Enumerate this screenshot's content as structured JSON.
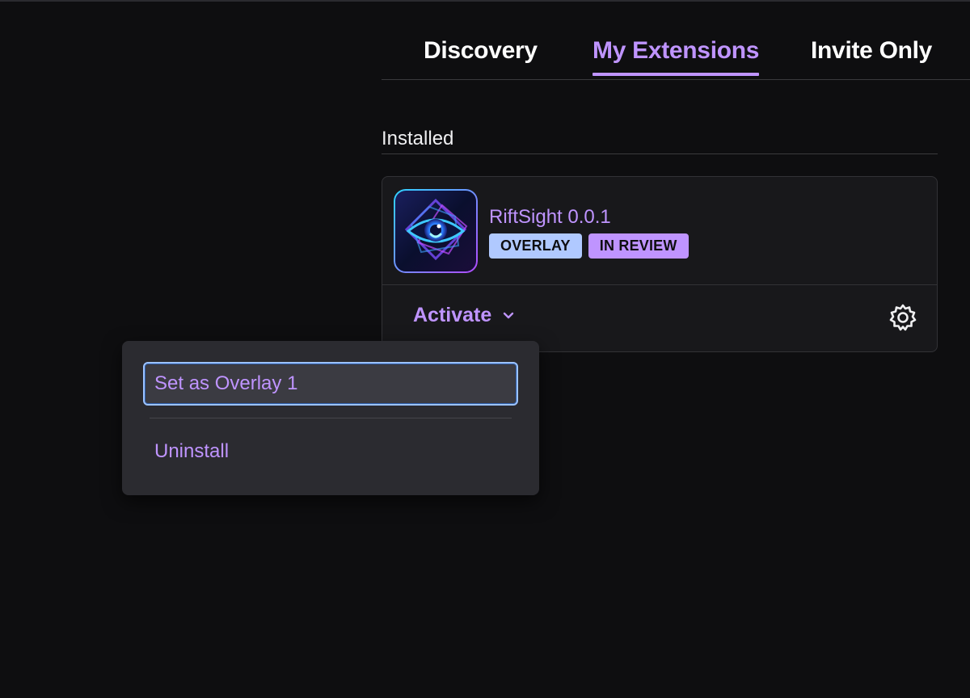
{
  "tabs": [
    {
      "label": "Discovery",
      "active": false
    },
    {
      "label": "My Extensions",
      "active": true
    },
    {
      "label": "Invite Only",
      "active": false
    }
  ],
  "section": {
    "title": "Installed"
  },
  "extension": {
    "name": "RiftSight 0.0.1",
    "logo_icon": "eye-diamond-logo",
    "badges": [
      {
        "label": "OVERLAY",
        "color": "#b0c9ff"
      },
      {
        "label": "IN REVIEW",
        "color": "#bf94ff"
      }
    ],
    "activate_label": "Activate",
    "settings_icon": "gear-icon"
  },
  "dropdown": {
    "items": [
      {
        "label": "Set as Overlay 1",
        "focused": true
      },
      {
        "label": "Uninstall",
        "focused": false
      }
    ]
  },
  "colors": {
    "accent": "#bf94ff",
    "background": "#0e0e10",
    "card": "#18181b",
    "focus_ring": "#9cc3ff"
  }
}
